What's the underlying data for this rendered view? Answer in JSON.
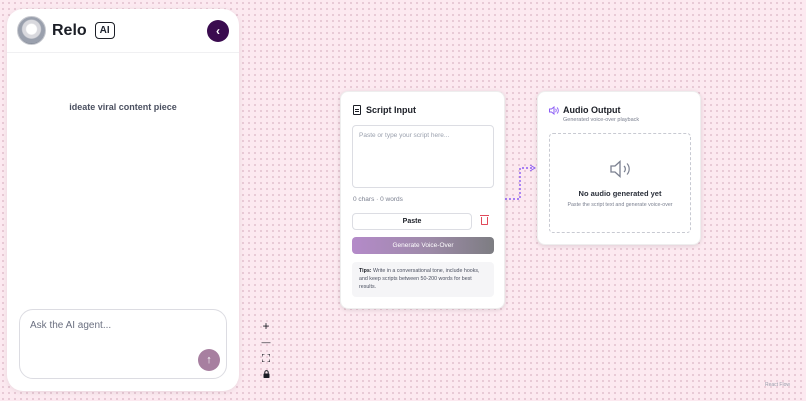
{
  "sidebar": {
    "brand": "Relo",
    "badge": "AI",
    "chat_items": [
      "ideate viral content piece"
    ],
    "input_placeholder": "Ask the AI agent..."
  },
  "controls": {
    "zoom_in": "+",
    "zoom_out": "—",
    "fit": "⛶",
    "lock": "🔒"
  },
  "script_node": {
    "title": "Script Input",
    "placeholder": "Paste or type your script here...",
    "counts": "0 chars · 0 words",
    "paste_label": "Paste",
    "generate_label": "Generate Voice-Over",
    "tips_label": "Tips:",
    "tips_text": " Write in a conversational tone, include hooks, and keep scripts between 50-200 words for best results."
  },
  "audio_node": {
    "title": "Audio Output",
    "subtitle": "Generated voice-over playback",
    "empty_title": "No audio generated yet",
    "empty_hint": "Paste the script text and generate voice-over"
  },
  "attribution": "React Flow",
  "colors": {
    "accent": "#8b5cf6",
    "collapse": "#3a0b4f",
    "send": "#a77fa0",
    "danger": "#e14a5a"
  }
}
